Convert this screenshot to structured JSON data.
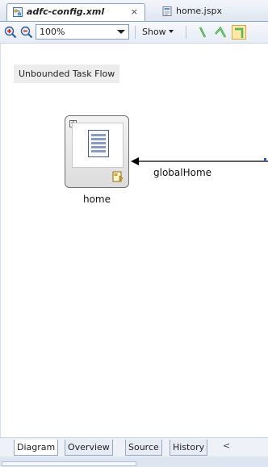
{
  "editor_tabs": [
    {
      "label": "adfc-config.xml",
      "icon": "xml-config-icon",
      "active": true,
      "close_label": "×"
    },
    {
      "label": "home.jspx",
      "icon": "jspx-file-icon",
      "active": false
    }
  ],
  "toolbar": {
    "zoom_in_icon": "zoom-in-icon",
    "zoom_out_icon": "zoom-out-icon",
    "zoom_value": "100%",
    "show_label": "Show",
    "connector_icons": [
      "straight-line-icon",
      "elbow-line-icon",
      "orthogonal-line-icon"
    ]
  },
  "canvas": {
    "panel_label": "Unbounded Task Flow",
    "node": {
      "label": "home",
      "icon": "view-page-icon",
      "badge_icon": "bookmark-icon",
      "expand_symbol": "+"
    },
    "edge": {
      "label": "globalHome"
    }
  },
  "bottom_tabs": [
    "Diagram",
    "Overview",
    "Source",
    "History"
  ],
  "scroll_left_symbol": "<",
  "colors": {
    "edge": "#000000",
    "accent_green": "#2e9a2e"
  }
}
